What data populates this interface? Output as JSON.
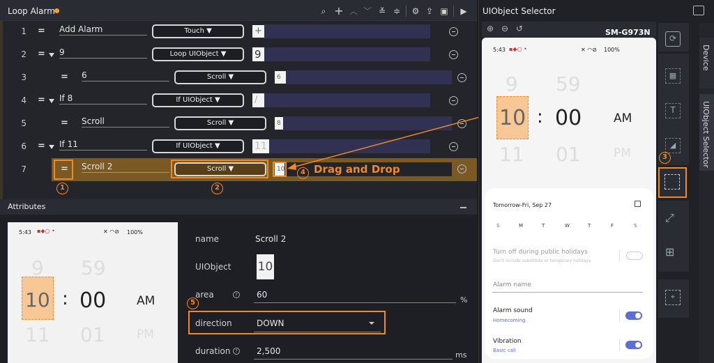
{
  "header": {
    "title": "Loop Alarm",
    "selector_title": "UIObject Selector"
  },
  "steps": [
    {
      "num": "1",
      "name": "Add Alarm",
      "command": "Touch ▼",
      "thumb": "+"
    },
    {
      "num": "2",
      "name": "9",
      "command": "Loop UIObject ▼",
      "thumb": "9"
    },
    {
      "num": "3",
      "name": "6",
      "command": "Scroll ▼",
      "thumb": "6"
    },
    {
      "num": "4",
      "name": "If 8",
      "command": "If UIObject ▼",
      "thumb": "/"
    },
    {
      "num": "5",
      "name": "Scroll",
      "command": "Scroll ▼",
      "thumb": "8"
    },
    {
      "num": "6",
      "name": "If 11",
      "command": "If UIObject ▼",
      "thumb": "11"
    },
    {
      "num": "7",
      "name": "Scroll 2",
      "command": "Scroll ▼",
      "thumb": "10"
    }
  ],
  "annotations": {
    "drag_label": "Drag and Drop",
    "b1": "1",
    "b2": "2",
    "b3": "3",
    "b4": "4",
    "b5": "5"
  },
  "attributes": {
    "title": "Attributes",
    "name_label": "name",
    "name_value": "Scroll 2",
    "uiobject_label": "UIObject",
    "uiobject_value": "10",
    "area_label": "area",
    "area_value": "60",
    "area_unit": "%",
    "direction_label": "direction",
    "direction_value": "DOWN",
    "duration_label": "duration",
    "duration_value": "2,500",
    "duration_unit": "ms"
  },
  "attr_phone": {
    "status": "5:43",
    "battery": "100%",
    "h_top": "9",
    "m_top": "59",
    "h_mid": "10",
    "sep": ":",
    "m_mid": "00",
    "ampm": "AM",
    "h_bot": "11",
    "m_bot": "01",
    "pm": "PM"
  },
  "device": {
    "model": "SM-G973N",
    "status": "5:43",
    "battery": "100%",
    "h_top": "9",
    "m_top": "59",
    "h_mid": "10",
    "sep": ":",
    "m_mid": "00",
    "ampm": "AM",
    "h_bot": "11",
    "m_bot": "01",
    "pm": "PM",
    "date": "Tomorrow-Fri, Sep 27",
    "days": [
      "S",
      "M",
      "T",
      "W",
      "T",
      "F",
      "S"
    ],
    "holiday_title": "Turn off during public holidays",
    "holiday_sub": "Don't include substitute or temporary holidays",
    "alarm_name": "Alarm name",
    "sound_title": "Alarm sound",
    "sound_sub": "Homecoming",
    "vib_title": "Vibration",
    "vib_sub": "Basic call"
  },
  "side_tabs": {
    "device": "Device",
    "selector": "UIObject Selector"
  },
  "colors": {
    "accent": "#f08a24",
    "bar": "#313251",
    "selected_row": "#7a5a22",
    "toggle": "#5b6ed8"
  }
}
